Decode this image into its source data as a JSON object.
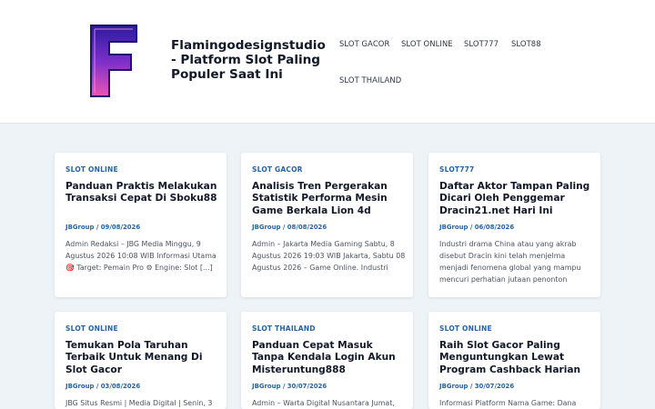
{
  "header": {
    "site_title": "Flamingodesignstudio - Platform Slot Paling Populer Saat Ini",
    "logo_letter": "F",
    "menu": [
      "SLOT GACOR",
      "SLOT ONLINE",
      "SLOT777",
      "SLOT88",
      "SLOT THAILAND"
    ]
  },
  "posts": [
    {
      "category": "SLOT ONLINE",
      "title": "Panduan Praktis Melakukan Transaksi Cepat Di Sboku88",
      "meta": "JBGroup / 09/08/2026",
      "excerpt": "Admin Redaksi – JBG Media Minggu, 9 Agustus 2026 10:08 WIB Informasi Utama 🎯 Target: Pemain Pro ⚙ Engine: Slot [...]"
    },
    {
      "category": "SLOT GACOR",
      "title": "Analisis Tren Pergerakan Statistik Performa Mesin Game Berkala Lion 4d",
      "meta": "JBGroup / 08/08/2026",
      "excerpt": "Admin – Jakarta Media Gaming Sabtu, 8 Agustus 2026 19:03 WIB Jakarta, Sabtu 08 Agustus 2026 – Game Online. Industri"
    },
    {
      "category": "SLOT777",
      "title": "Daftar Aktor Tampan Paling Dicari Oleh Penggemar Dracin21.net Hari Ini",
      "meta": "JBGroup / 06/08/2026",
      "excerpt": "Industri drama China atau yang akrab disebut Dracin kini telah menjelma menjadi fenomena global yang mampu mencuri perhatian jutaan penonton"
    },
    {
      "category": "SLOT ONLINE",
      "title": "Temukan Pola Taruhan Terbaik Untuk Menang Di Slot Gacor",
      "meta": "JBGroup / 03/08/2026",
      "excerpt": "JBG Situs Resmi | Media Digital | Senin, 3"
    },
    {
      "category": "SLOT THAILAND",
      "title": "Panduan Cepat Masuk Tanpa Kendala Login Akun Misteruntung888",
      "meta": "JBGroup / 30/07/2026",
      "excerpt": "Admin – Warta Digital Nusantara Jumat,"
    },
    {
      "category": "SLOT ONLINE",
      "title": "Raih Slot Gacor Paling Menguntungkan Lewat Program Cashback Harian",
      "meta": "JBGroup / 30/07/2026",
      "excerpt": "Informasi Platform Nama Game: Dana"
    }
  ],
  "colors": {
    "accent": "#2563a6",
    "background": "#eef3f8",
    "logo_purple": "#3b1fb8",
    "logo_pink": "#e84bb8"
  }
}
